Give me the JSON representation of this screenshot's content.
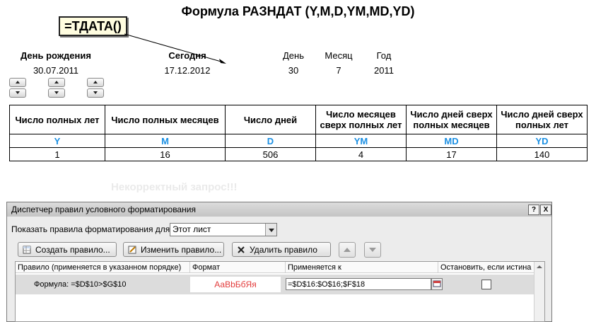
{
  "sheet": {
    "title": "Формула РАЗНДАТ (Y,M,D,YM,MD,YD)",
    "formula_note": "=ТДАТА()",
    "birth_label": "День рождения",
    "birth_value": "30.07.2011",
    "today_label": "Сегодня",
    "today_value": "17.12.2012",
    "day_label": "День",
    "day_value": "30",
    "month_label": "Месяц",
    "month_value": "7",
    "year_label": "Год",
    "year_value": "2011",
    "error_text": "Некорректный запрос!!!",
    "table": {
      "headers": [
        "Число полных лет",
        "Число полных месяцев",
        "Число дней",
        "Число месяцев сверх полных лет",
        "Число дней сверх полных месяцев",
        "Число дней сверх полных лет"
      ],
      "codes": [
        "Y",
        "M",
        "D",
        "YM",
        "MD",
        "YD"
      ],
      "values": [
        "1",
        "16",
        "506",
        "4",
        "17",
        "140"
      ]
    }
  },
  "dialog": {
    "title": "Диспетчер правил условного форматирования",
    "help_label": "?",
    "close_label": "X",
    "show_label": "Показать правила форматирования для:",
    "show_value": "Этот лист",
    "new_rule": "Создать правило...",
    "edit_rule": "Изменить правило...",
    "delete_rule": "Удалить правило",
    "columns": {
      "rule": "Правило (применяется в указанном порядке)",
      "format": "Формат",
      "applies": "Применяется к",
      "stop": "Остановить, если истина"
    },
    "rule_row": {
      "rule": "Формула: =$D$10>$G$10",
      "preview": "АаВbБбЯя",
      "applies": "=$D$16:$O$16;$F$18"
    }
  },
  "colors": {
    "code_blue": "#1a8fe3",
    "preview_red": "#e23a3a",
    "note_bg": "#fffde0"
  }
}
